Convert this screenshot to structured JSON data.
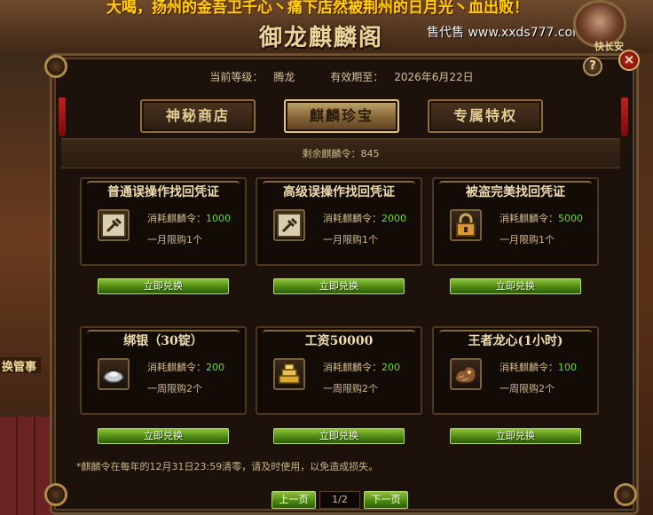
{
  "background": {
    "announcement": "大喝，扬州的金吾卫千心丶痛下店然被荆州的日月光丶血出败！",
    "brand_title": "御龙麒麟阁",
    "watermark": "售代售 www.xxds777.com",
    "left_label": "换管事",
    "avatar_tag": "快长安"
  },
  "header": {
    "level_label": "当前等级：",
    "level_value": "腾龙",
    "expiry_label": "有效期至：",
    "expiry_value": "2026年6月22日"
  },
  "controls": {
    "help": "?",
    "close": "×"
  },
  "tabs": [
    {
      "label": "神秘商店",
      "active": false
    },
    {
      "label": "麒麟珍宝",
      "active": true
    },
    {
      "label": "专属特权",
      "active": false
    }
  ],
  "balance": {
    "label": "剩余麒麟令：",
    "value": "845"
  },
  "items": [
    {
      "title": "普通误操作找回凭证",
      "cost_label": "消耗麒麟令：",
      "cost": "1000",
      "limit": "一月限购1个",
      "icon": "repair-card-icon",
      "button": "立即兑换"
    },
    {
      "title": "高级误操作找回凭证",
      "cost_label": "消耗麒麟令：",
      "cost": "2000",
      "limit": "一月限购1个",
      "icon": "repair-card-icon",
      "button": "立即兑换"
    },
    {
      "title": "被盗完美找回凭证",
      "cost_label": "消耗麒麟令：",
      "cost": "5000",
      "limit": "一月限购1个",
      "icon": "lock-icon",
      "button": "立即兑换"
    },
    {
      "title": "绑银（30锭）",
      "cost_label": "消耗麒麟令：",
      "cost": "200",
      "limit": "一周限购2个",
      "icon": "silver-ingot-icon",
      "button": "立即兑换"
    },
    {
      "title": "工资50000",
      "cost_label": "消耗麒麟令：",
      "cost": "200",
      "limit": "一周限购2个",
      "icon": "gold-stack-icon",
      "button": "立即兑换"
    },
    {
      "title": "王者龙心(1小时)",
      "cost_label": "消耗麒麟令：",
      "cost": "100",
      "limit": "一周限购2个",
      "icon": "dragon-heart-icon",
      "button": "立即兑换"
    }
  ],
  "note": "*麒麟令在每年的12月31日23:59清零，请及时使用，以免造成损失。",
  "pager": {
    "prev": "上一页",
    "page": "1/2",
    "next": "下一页"
  },
  "colors": {
    "accent_green": "#6edb2a",
    "button_green": "#4e8a12",
    "gold": "#e3cd94",
    "close_red": "#c02a1a"
  }
}
